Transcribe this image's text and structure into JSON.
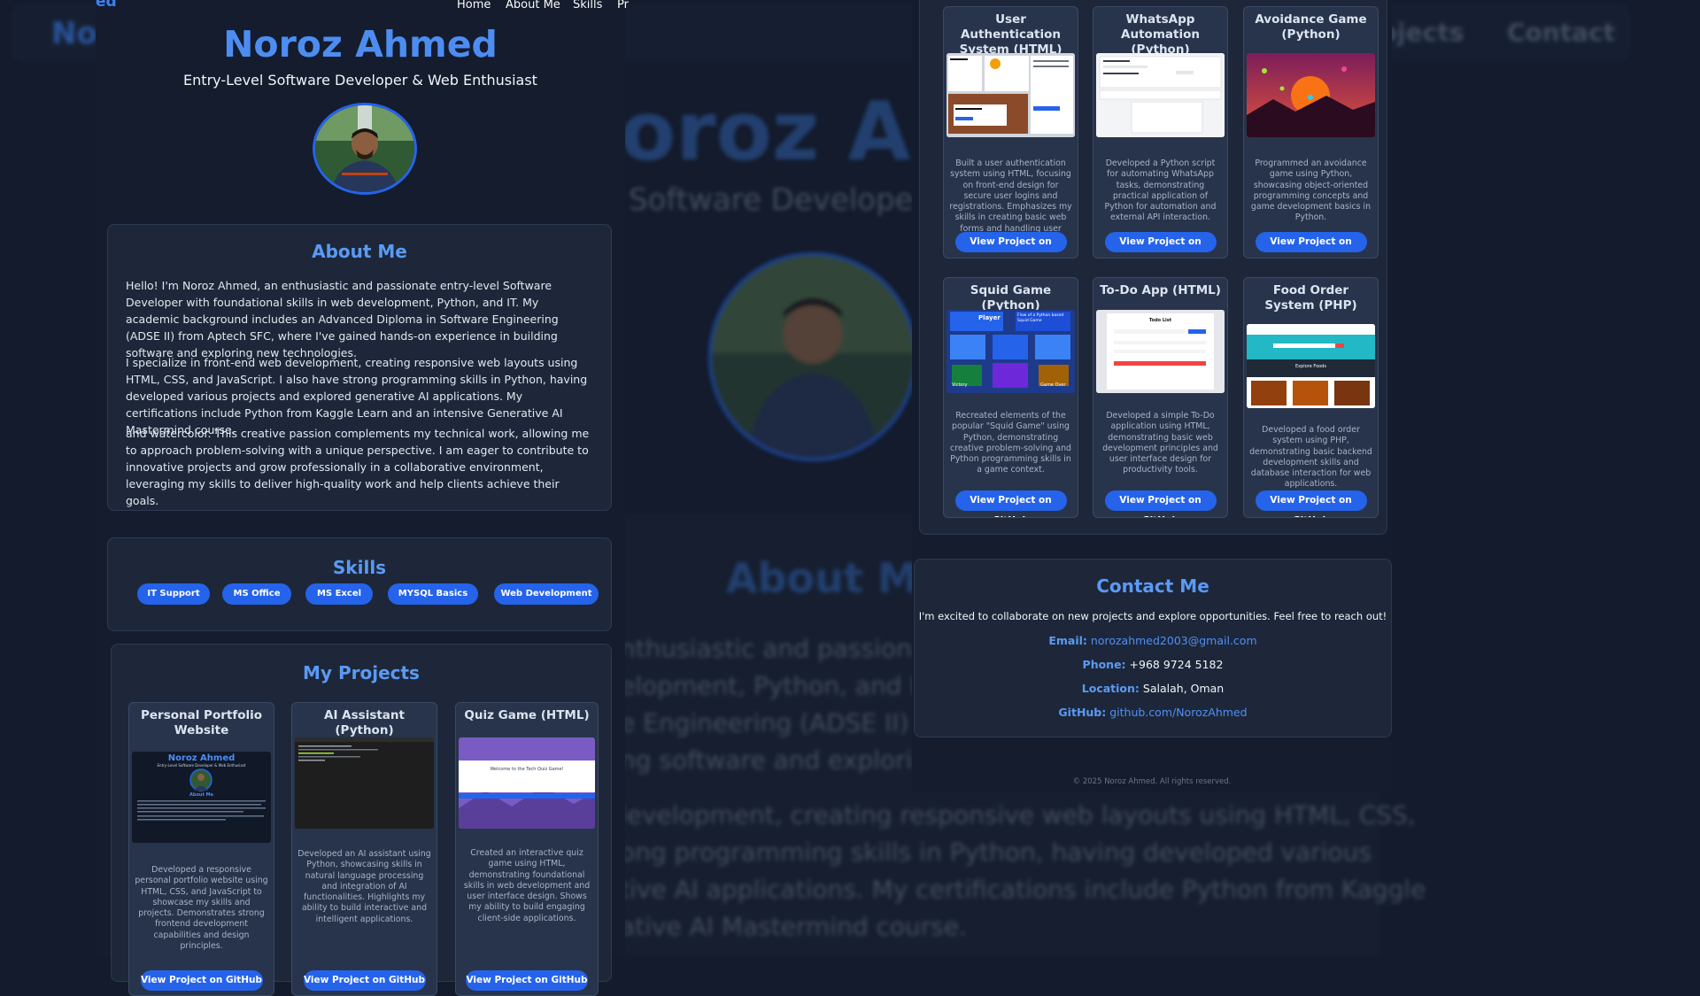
{
  "site": {
    "brand": "Noroz Ahmed",
    "brand_fragment": "ed",
    "nav": [
      "Home",
      "About Me",
      "Skills",
      "Projects",
      "Contact"
    ],
    "nav_visible_partial": "Pr",
    "bg_nav_fragment_left": "No",
    "bg_nav_projects": "rojects",
    "bg_nav_contact": "Contact"
  },
  "hero": {
    "name": "Noroz Ahmed",
    "subtitle": "Entry-Level Software Developer & Web Enthusiast",
    "bg_name_fragment": "oroz Ah",
    "bg_subtitle_fragment": "Software Develope"
  },
  "about": {
    "title": "About Me",
    "bg_title": "About Me",
    "paragraphs": [
      "Hello! I'm Noroz Ahmed, an enthusiastic and passionate entry-level Software Developer with foundational skills in web development, Python, and IT. My academic background includes an Advanced Diploma in Software Engineering (ADSE II) from Aptech SFC, where I've gained hands-on experience in building software and exploring new technologies.",
      "I specialize in front-end web development, creating responsive web layouts using HTML, CSS, and JavaScript. I also have strong programming skills in Python, having developed various projects and explored generative AI applications. My certifications include Python from Kaggle Learn and an intensive Generative AI Mastermind course.",
      "and watercolor. This creative passion complements my technical work, allowing me to approach problem-solving with a unique perspective. I am eager to contribute to innovative projects and grow professionally in a collaborative environment, leveraging my skills to deliver high-quality work and help clients achieve their goals."
    ],
    "bg_lines": [
      "nthusiastic and passionate",
      "elopment, Python, and IT. M",
      "e Engineering (ADSE II) fro",
      "ng software and exploring",
      "levelopment, creating responsive web layouts using HTML, CSS,",
      "ong programming skills in Python, having developed various",
      "tive AI applications. My certifications include Python from Kaggle",
      "ative AI Mastermind course."
    ]
  },
  "skills": {
    "title": "Skills",
    "items": [
      "IT Support",
      "MS Office",
      "MS Excel",
      "MYSQL Basics",
      "Web Development"
    ]
  },
  "projects": {
    "title": "My Projects",
    "button_label": "View Project on GitHub",
    "items": [
      {
        "title": "Personal Portfolio Website",
        "desc": "Developed a responsive personal portfolio website using HTML, CSS, and JavaScript to showcase my skills and projects. Demonstrates strong frontend development capabilities and design principles."
      },
      {
        "title": "AI Assistant (Python)",
        "desc": "Developed an AI assistant using Python, showcasing skills in natural language processing and integration of AI functionalities. Highlights my ability to build interactive and intelligent applications."
      },
      {
        "title": "Quiz Game (HTML)",
        "desc": "Created an interactive quiz game using HTML, demonstrating foundational skills in web development and user interface design. Shows my ability to build engaging client-side applications."
      },
      {
        "title": "User Authentication System (HTML)",
        "desc": "Built a user authentication system using HTML, focusing on front-end design for secure user logins and registrations. Emphasizes my skills in creating basic web forms and handling user input."
      },
      {
        "title": "WhatsApp Automation (Python)",
        "desc": "Developed a Python script for automating WhatsApp tasks, demonstrating practical application of Python for automation and external API interaction."
      },
      {
        "title": "Avoidance Game (Python)",
        "desc": "Programmed an avoidance game using Python, showcasing object-oriented programming concepts and game development basics in Python."
      },
      {
        "title": "Squid Game (Python)",
        "desc": "Recreated elements of the popular \"Squid Game\" using Python, demonstrating creative problem-solving and Python programming skills in a game context."
      },
      {
        "title": "To-Do App (HTML)",
        "desc": "Developed a simple To-Do application using HTML, demonstrating basic web development principles and user interface design for productivity tools."
      },
      {
        "title": "Food Order System (PHP)",
        "desc": "Developed a food order system using PHP, demonstrating basic backend development skills and database interaction for web applications."
      }
    ],
    "thumb_texts": {
      "portfolio_name": "Noroz Ahmed",
      "portfolio_sub": "Entry-Level Software Developer & Web Enthusiast",
      "portfolio_about": "About Me",
      "quiz_text": "Welcome to the Tech Quiz Game!",
      "squid_player": "Player",
      "squid_caption": "Flow of a Python based Squid Game",
      "squid_victory": "Victory",
      "squid_gameover": "Game Over",
      "todo_title": "Todo List",
      "food_banner": "Explore Foods"
    }
  },
  "contact": {
    "title": "Contact Me",
    "intro": "I'm excited to collaborate on new projects and explore opportunities. Feel free to reach out!",
    "email_label": "Email:",
    "email": "norozahmed2003@gmail.com",
    "phone_label": "Phone:",
    "phone": "+968 9724 5182",
    "location_label": "Location:",
    "location": "Salalah, Oman",
    "github_label": "GitHub:",
    "github": "github.com/NorozAhmed"
  },
  "footer": {
    "text": "© 2025 Noroz Ahmed. All rights reserved."
  },
  "colors": {
    "accent": "#2563eb",
    "heading": "#4d8df2",
    "bg": "#131b2c",
    "card": "#1d2739"
  }
}
